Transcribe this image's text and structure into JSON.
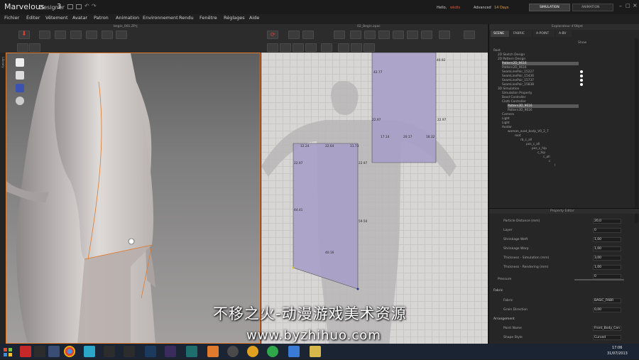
{
  "app": {
    "brand": "Marvelous",
    "subbrand": "Designer",
    "version": "3",
    "greeting": "Hello,",
    "user": "wkdis",
    "license": "Advanced",
    "days_left": "14 Days",
    "simulation_tab": "SIMULATION",
    "animation_tab": "ANIMATION"
  },
  "menu": [
    "Fichier",
    "Éditer",
    "Vêtement",
    "Avatar",
    "Patron",
    "Animation",
    "Environnement",
    "Rendu",
    "Fenêtre",
    "Réglages",
    "Aide"
  ],
  "view3d": {
    "title": "begin_001.ZPrj",
    "side_label": "Library"
  },
  "view2d": {
    "title": "02_Begin.zpac"
  },
  "pattern_dims": {
    "top": [
      "42.77",
      "40.92",
      "22.97",
      "22.97",
      "17.14",
      "20.17",
      "18.32"
    ],
    "front": [
      "12.24",
      "22.64",
      "11.73",
      "22.97",
      "22.97",
      "44.41",
      "59.50",
      "40.16"
    ]
  },
  "object_browser": {
    "title": "Explorateur d'Objet",
    "tabs": [
      "SCENE",
      "FABRIC",
      "A-POINT",
      "A-BV"
    ],
    "show": "Show",
    "tree": [
      "Root",
      "2D Sketch Design",
      "2D Pattern Design",
      "Pattern2D_9616",
      "Pattern2D_9616",
      "SeamLinePair_15227",
      "SeamLinePair_15436",
      "SeamLinePair_15737",
      "SeamLinePair_15838",
      "3D Simulation",
      "Simulation Property",
      "Band Controller",
      "Cloth Controller",
      "Pattern3D_9616",
      "Pattern3D_9616",
      "Camera",
      "Light",
      "Light",
      "Avatar",
      "woman_avat_body_V0_2_7",
      "root",
      "rb_c_all",
      "pos_c_all",
      "pos_c_hip",
      "c_hip",
      "c_all",
      "c",
      "l"
    ]
  },
  "property_editor": {
    "title": "Property Editor",
    "rows": [
      {
        "label": "Particle Distance (mm)",
        "value": "20,0"
      },
      {
        "label": "Layer",
        "value": "0"
      },
      {
        "label": "Shrinkage Weft",
        "value": "1,00"
      },
      {
        "label": "Shrinkage Warp",
        "value": "1,00"
      },
      {
        "label": "Thickness - Simulation (mm)",
        "value": "3,00"
      },
      {
        "label": "Thickness - Rendering (mm)",
        "value": "1,00"
      },
      {
        "label": "",
        "value": "0"
      }
    ],
    "pressure": "Pressure",
    "fabric_section": "Fabric",
    "fabric_label": "Fabric",
    "fabric_value": "BASIC_FABR",
    "grain_label": "Grain Direction",
    "grain_value": "0,00",
    "arrangement_section": "Arrangement",
    "arr_point_label": "Point Name",
    "arr_point_value": "Front_Body_Cen",
    "shape_label": "Shape Style",
    "shape_value": "Curved"
  },
  "taskbar": {
    "time": "17:06",
    "date": "31/07/2013"
  },
  "watermark": {
    "line1": "不移之火-动漫游戏美术资源",
    "line2": "www.byzhihuo.com"
  },
  "colors": {
    "accent_orange": "#e07a2c",
    "selection_purple": "#a9a0c8",
    "license_days": "#e8a33a"
  }
}
